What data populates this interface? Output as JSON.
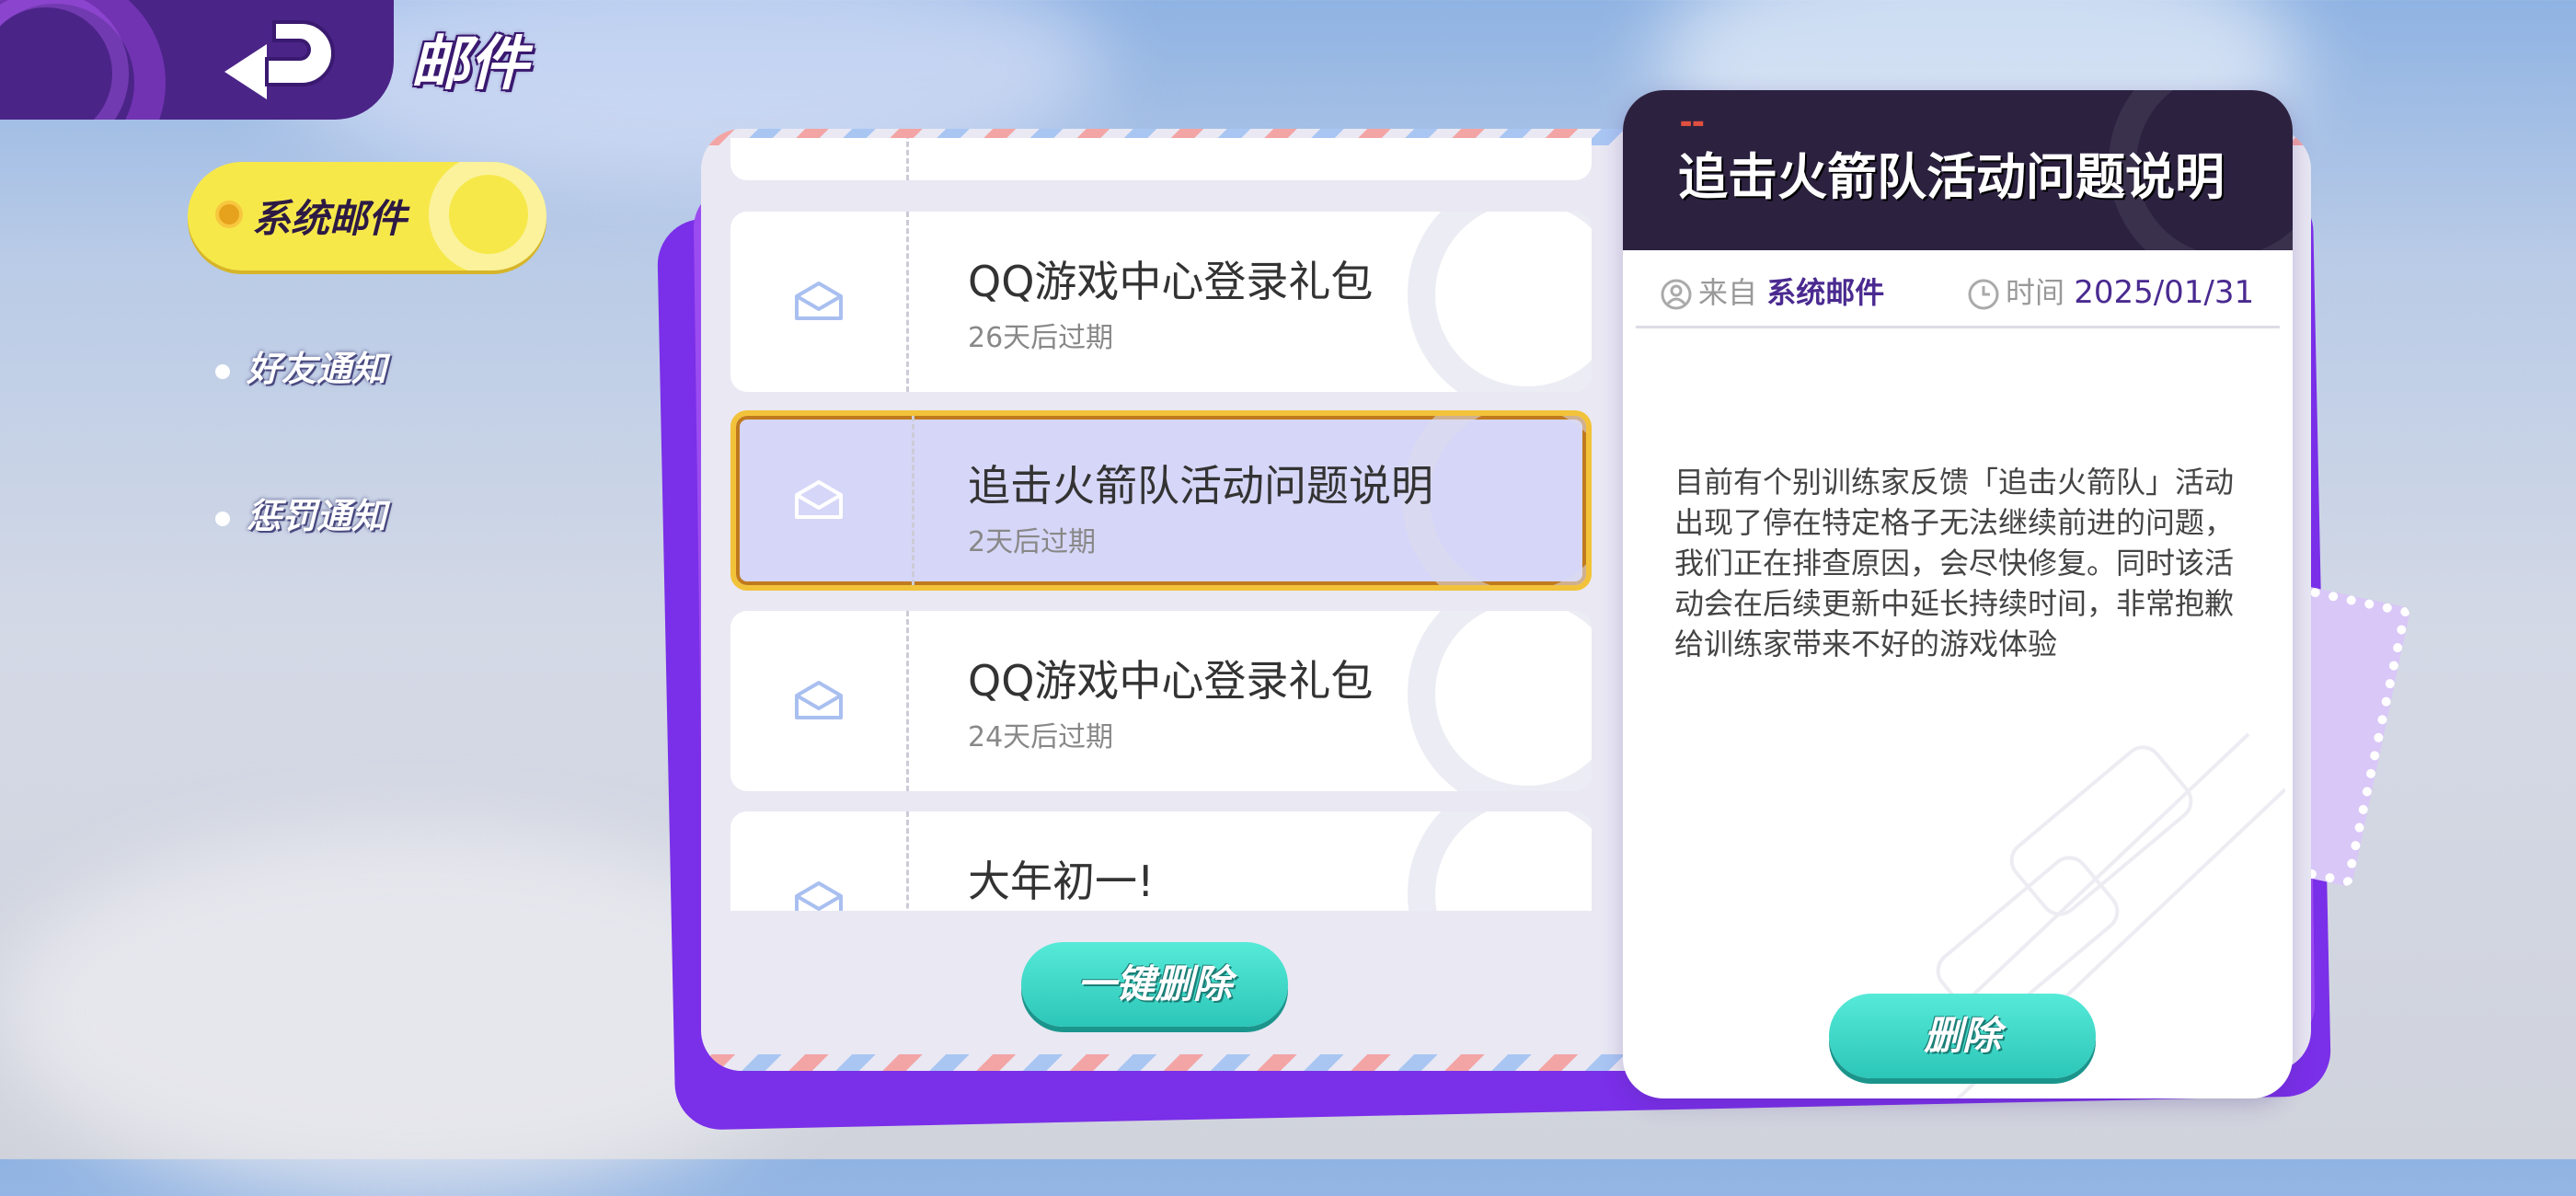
{
  "header": {
    "title": "邮件"
  },
  "sidebar": {
    "items": [
      {
        "label": "系统邮件",
        "active": true
      },
      {
        "label": "好友通知",
        "active": false
      },
      {
        "label": "惩罚通知",
        "active": false
      }
    ]
  },
  "mail_list": {
    "items": [
      {
        "title": "QQ游戏中心登录礼包",
        "expire": "26天后过期",
        "selected": false
      },
      {
        "title": "追击火箭队活动问题说明",
        "expire": "2天后过期",
        "selected": true
      },
      {
        "title": "QQ游戏中心登录礼包",
        "expire": "24天后过期",
        "selected": false
      },
      {
        "title": "大年初一!",
        "expire": "",
        "selected": false
      }
    ],
    "delete_all_label": "一键删除"
  },
  "detail": {
    "title": "追击火箭队活动问题说明",
    "from_label": "来自",
    "from_value": "系统邮件",
    "time_label": "时间",
    "time_value": "2025/01/31",
    "body": "目前有个别训练家反馈「追击火箭队」活动出现了停在特定格子无法继续前进的问题，我们正在排查原因，会尽快修复。同时该活动会在后续更新中延长持续时间，非常抱歉给训练家带来不好的游戏体验",
    "delete_label": "删除"
  },
  "colors": {
    "accent_purple": "#4b2488",
    "selected_yellow": "#f7e84a",
    "button_teal": "#2cc6b8"
  }
}
